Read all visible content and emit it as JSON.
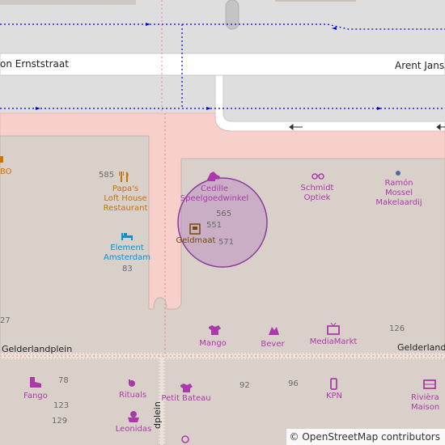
{
  "streets": {
    "van_ernststraat": "on Ernststraat",
    "arent_jansz": "Arent Jansz",
    "gelderlandplein_left": "Gelderlandplein",
    "gelderlandplein_right": "Gelderland",
    "gelderlandplein_vertical": "dplein"
  },
  "pois": {
    "papas": "Papa's\nLoft House\nRestaurant",
    "cedille": "Cedille\nSpeelgoedwinkel",
    "schmidt": "Schmidt\nOptiek",
    "ramon": "Ramón\nMossel\nMakelaardij",
    "geldmaat": "Geldmaat",
    "element": "Element\nAmsterdam",
    "mango": "Mango",
    "bever": "Bever",
    "mediamarkt": "MediaMarkt",
    "fango": "Fango",
    "rituals": "Rituals",
    "petit_bateau": "Petit Bateau",
    "kpn": "KPN",
    "riviera": "Rivièra\nMaison",
    "leonidas": "Leonidas",
    "bo": "BO"
  },
  "house_numbers": {
    "n585": "585",
    "n565": "565",
    "n551": "551",
    "n571": "571",
    "n83": "83",
    "n27": "27",
    "n126": "126",
    "n78": "78",
    "n123": "123",
    "n129": "129",
    "n92": "92",
    "n96": "96"
  },
  "icons": {
    "papas": "restaurant-icon",
    "cedille": "toy-horse-icon",
    "schmidt": "glasses-icon",
    "ramon": "dot-icon",
    "geldmaat": "atm-icon",
    "element": "hotel-bed-icon",
    "mango": "clothes-icon",
    "bever": "outdoor-icon",
    "mediamarkt": "tv-icon",
    "fango": "shoe-icon",
    "rituals": "cosmetics-icon",
    "petit_bateau": "clothes-icon",
    "kpn": "mobile-phone-icon",
    "riviera": "furniture-icon",
    "leonidas": "confectionery-icon",
    "jewelry": "jewelry-icon"
  },
  "attribution": "© OpenStreetMap contributors",
  "colors": {
    "pedestrian": "#f7d0cc",
    "building": "#d9d0c9",
    "road": "#ffffff",
    "parking": "#dedede",
    "cycleway": "#0000ff",
    "accuracy_circle": "#b070c0"
  }
}
